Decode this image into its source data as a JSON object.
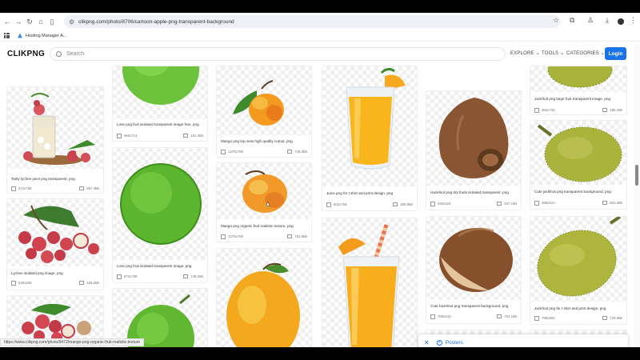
{
  "browser": {
    "url": "clikpng.com/photo/8706/cartoon-apple-png-transparent-background",
    "bookmark_label": "Hosting Manager A..."
  },
  "site": {
    "logo": "CLIKPNG",
    "search_placeholder": "Search",
    "menu": [
      "EXPLORE",
      "TOOLS",
      "CATEGORIES"
    ],
    "login_label": "Login"
  },
  "cards": [
    {
      "caption": "Tasty lychee juice png transparent, png",
      "dims": "672x768",
      "size": "857.3kB"
    },
    {
      "caption": "Lychee isolated png image, png",
      "dims": "630x609",
      "size": "628.6kB"
    },
    {
      "caption": "Lime png fruit isolated transparent image free, png",
      "dims": "560x714",
      "size": "191.3kB"
    },
    {
      "caption": "Lime png fruit isolated transparent image, png",
      "dims": "672x768",
      "size": "748.2kB"
    },
    {
      "caption": "Mango png top view high quality cutout, png",
      "dims": "1376x768",
      "size": "745.6kB"
    },
    {
      "caption": "Mango png organic fruit realistic texture, png",
      "dims": "1376x768",
      "size": "781.5kB"
    },
    {
      "caption": "Juice png for t shirt and print design, png",
      "dims": "602x768",
      "size": "480.9kB"
    },
    {
      "caption": "Hazelnut png dry fruits isolated transparent, png",
      "dims": "635x624",
      "size": "637.1kB"
    },
    {
      "caption": "Cute hazelnut png transparent background, png",
      "dims": "768x633",
      "size": "754.1kB"
    },
    {
      "caption": "Jackfruit png large fruit transparent image, png",
      "dims": "384x733",
      "size": "486.2kB"
    },
    {
      "caption": "Cute jackfruit png transparent background, png",
      "dims": "386x610",
      "size": "691.3kB"
    },
    {
      "caption": "Jackfruit png for t shirt and print design, png",
      "dims": "786x682",
      "size": "728.8kB"
    }
  ],
  "status_url": "https://www.clikpng.com/photo/9472/mango-png-organic-fruit-realistic-texture",
  "posters_label": "Posters",
  "icons": {
    "back": "arrow-left-icon",
    "forward": "arrow-right-icon",
    "reload": "reload-icon",
    "home": "home-icon",
    "sidebar": "sidebar-icon",
    "star": "star-icon",
    "extensions": "puzzle-icon",
    "download": "download-icon"
  },
  "colors": {
    "accent": "#1a73e8",
    "text": "#111111"
  }
}
